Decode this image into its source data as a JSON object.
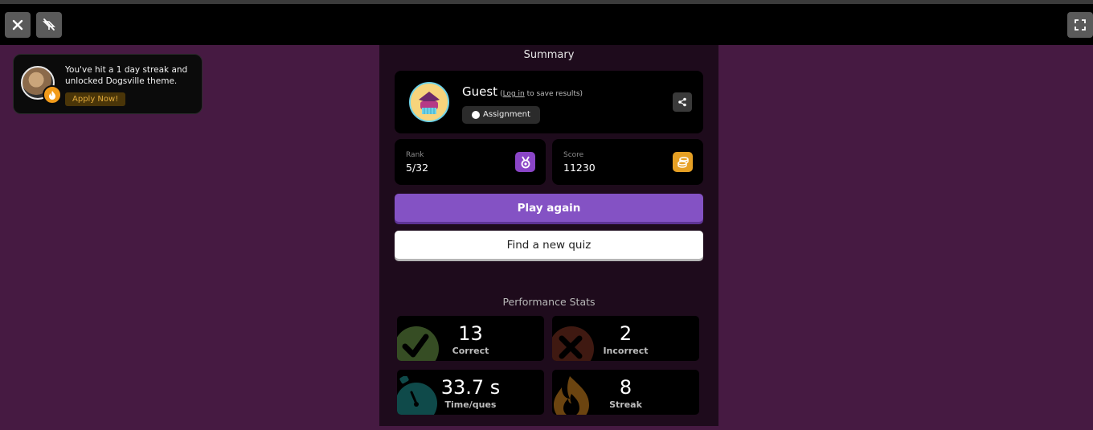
{
  "topbar": {
    "close_icon": "close-icon",
    "theme_icon": "no-theme-icon",
    "fullscreen_icon": "fullscreen-icon"
  },
  "toast": {
    "message": "You've hit a 1 day streak and unlocked Dogsville theme.",
    "button": "Apply Now!",
    "badge_icon": "flame-icon"
  },
  "summary": {
    "title": "Summary",
    "user": {
      "name": "Guest",
      "note_open": "(",
      "login_link": "Log in",
      "note_rest": " to save results)",
      "tag": "Assignment"
    },
    "rank": {
      "label": "Rank",
      "value": "5/32",
      "icon": "medal-icon",
      "color": "#8a45c7"
    },
    "score": {
      "label": "Score",
      "value": "11230",
      "icon": "coins-icon",
      "color": "#e6a024"
    },
    "play_again": "Play again",
    "find_quiz": "Find a new quiz"
  },
  "performance": {
    "title": "Performance Stats",
    "correct": {
      "value": "13",
      "label": "Correct",
      "icon": "check-icon"
    },
    "incorrect": {
      "value": "2",
      "label": "Incorrect",
      "icon": "cross-icon"
    },
    "time": {
      "value": "33.7 s",
      "label": "Time/ques",
      "icon": "stopwatch-icon"
    },
    "streak": {
      "value": "8",
      "label": "Streak",
      "icon": "flame-icon"
    }
  },
  "colors": {
    "background": "#461a42",
    "panel": "#1e0b1c",
    "primary_button": "#8452c4"
  }
}
